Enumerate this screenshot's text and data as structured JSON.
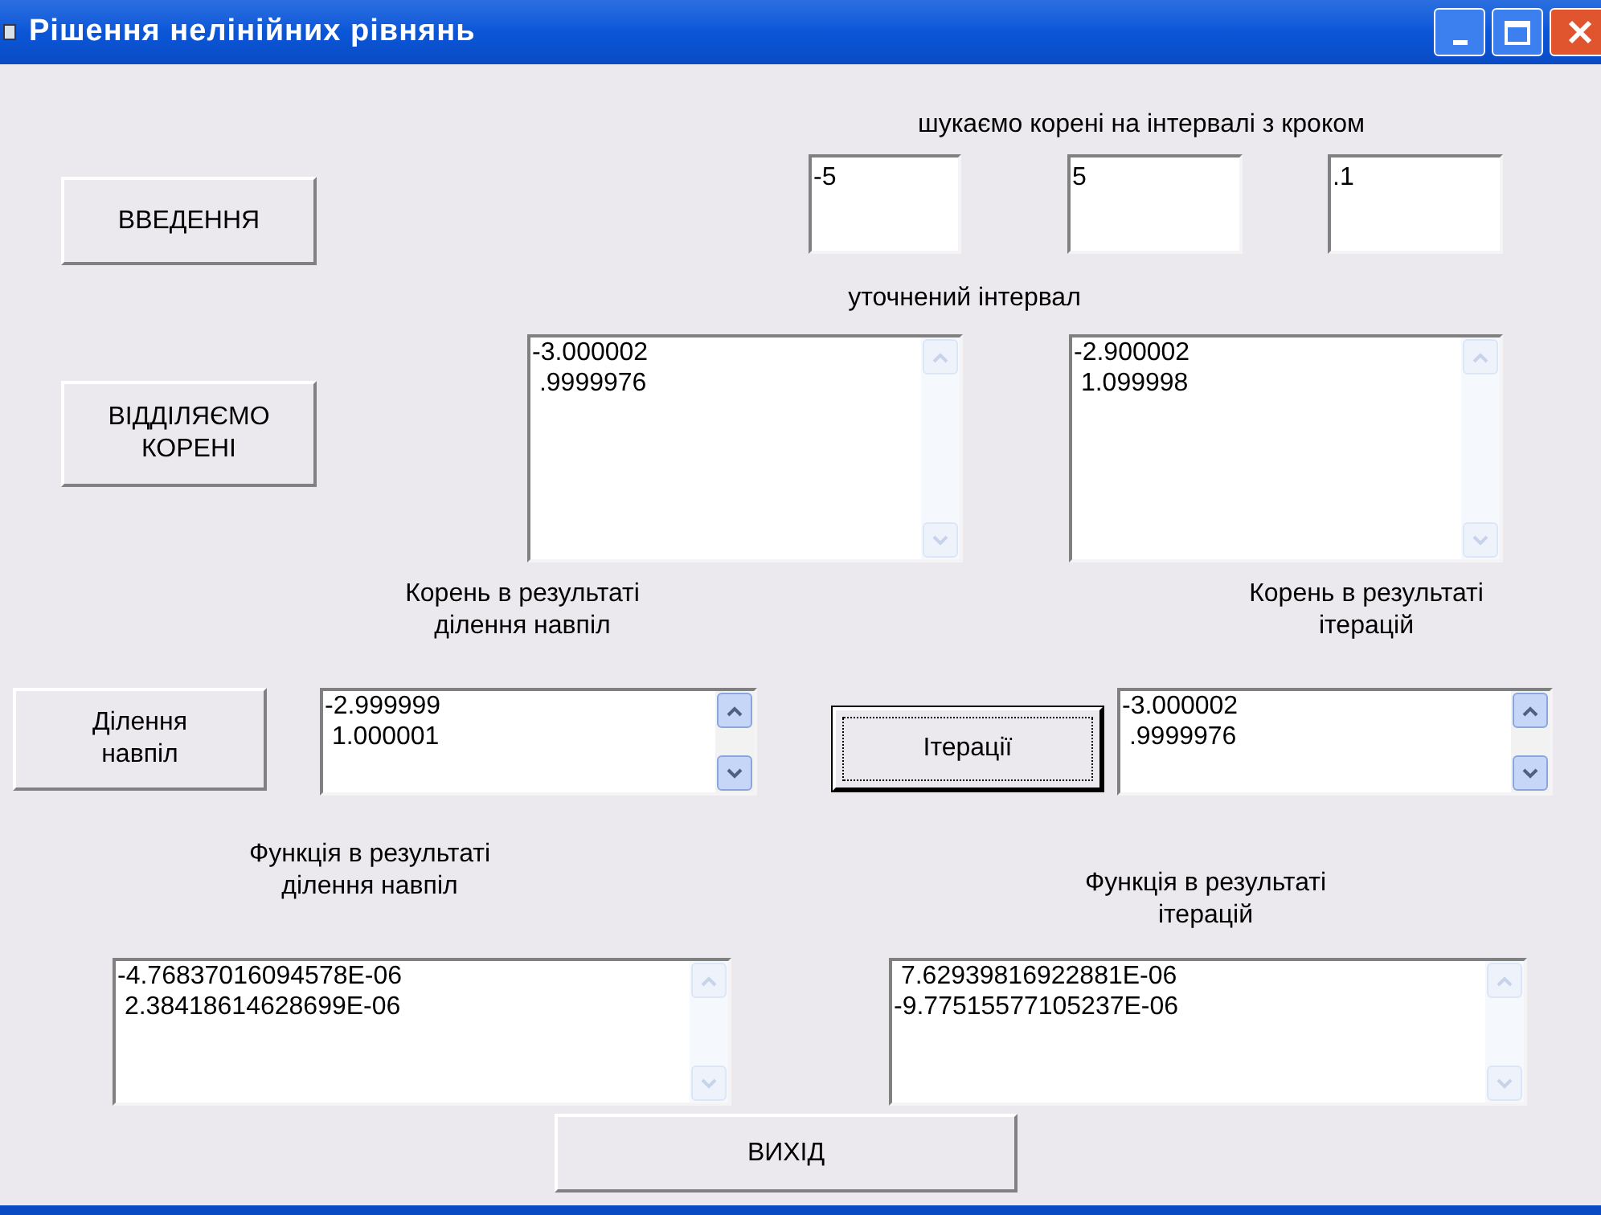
{
  "window": {
    "title": "Рішення нелінійних рівнянь"
  },
  "labels": [
    {
      "text": "шукаємо корені на інтервалі з кроком"
    },
    {
      "text": "уточнений інтервал"
    },
    {
      "text": "Корень в результаті\nділення навпіл"
    },
    {
      "text": "Корень в результаті\nітерацій"
    },
    {
      "text": "Функція в результаті\nділення навпіл"
    },
    {
      "text": "Функція в результаті\nітерацій"
    }
  ],
  "fields": [
    {
      "value": "-5"
    },
    {
      "value": "5"
    },
    {
      "value": ".1"
    }
  ],
  "lists": [
    {
      "items": [
        "-3.000002",
        " .9999976"
      ],
      "scroll_disabled": true
    },
    {
      "items": [
        "-2.900002",
        " 1.099998"
      ],
      "scroll_disabled": true
    },
    {
      "items": [
        "-2.999999",
        " 1.000001"
      ],
      "scroll_disabled": false
    },
    {
      "items": [
        "-3.000002",
        " .9999976"
      ],
      "scroll_disabled": false
    },
    {
      "items": [
        "-4.76837016094578E-06",
        " 2.38418614628699E-06"
      ],
      "scroll_disabled": true
    },
    {
      "items": [
        " 7.62939816922881E-06",
        "-9.77515577105237E-06"
      ],
      "scroll_disabled": true
    }
  ],
  "buttons": [
    {
      "label": "ВВЕДЕННЯ",
      "focused": false
    },
    {
      "label": "ВІДДІЛЯЄМО\nКОРЕНІ",
      "focused": false
    },
    {
      "label": "Ділення\nнавпіл",
      "focused": false
    },
    {
      "label": "Ітерації",
      "focused": true
    },
    {
      "label": "ВИХІД",
      "focused": false
    }
  ]
}
